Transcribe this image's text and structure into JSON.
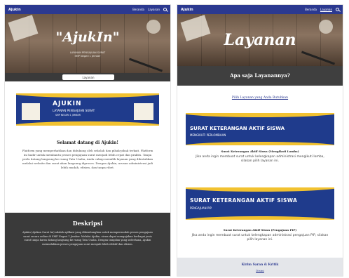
{
  "left": {
    "navbar": {
      "brand": "Ajukin",
      "links": [
        "Beranda",
        "Layanan"
      ]
    },
    "hero": {
      "title": "\"AjukIn\"",
      "sub1": "LAYANAN PENGAJUAN SURAT",
      "sub2": "SMP Negeri 1 Jember",
      "button": "Layanan"
    },
    "banner": {
      "title": "AJUKIN",
      "subtitle": "LAYANAN PENGAJUAN SURAT",
      "line": "SMP NEGERI 1 JEMBER"
    },
    "welcome": {
      "title": "Selamat datang di Ajukin!",
      "text": "Platform yang memperhatikan dan didukung oleh sekolah dan pihak-pihak terkait. Platform ini hadir untuk membantu proses pengajuan surat menjadi lebih cepat dan praktis. Tanpa perlu datang langsung ke ruang Tata Usaha, Anda cukup memilih layanan yang dibutuhkan melalui website dan surat akan langsung diproses. Dengan Ajukin, urusan administrasi jadi lebih mudah, efisien, dan tanpa ribet."
    },
    "deskripsi": {
      "title": "Deskripsi",
      "text": "Ajukin (Ajukan Surat Ini) adalah aplikasi yang dikembangkan untuk mempermudah proses pengajuan surat secara online di SMP Negeri 1 Jember. Melalui Ajukin, siswa dapat mengajukan berbagai jenis surat tanpa harus datang langsung ke ruang Tata Usaha. Dengan tampilan yang sederhana, Ajukin memudahkan proses pengajuan surat menjadi lebih efektif dan efisien."
    }
  },
  "right": {
    "navbar": {
      "brand": "Ajukin",
      "links": [
        "Beranda",
        "Layanan"
      ]
    },
    "hero": {
      "title": "Layanan"
    },
    "question": "Apa saja Layanannya?",
    "choose_link": "Pilih Layanan yang Anda Butuhkan",
    "cards": [
      {
        "banner_title": "SURAT KETERANGAN AKTIF SISWA",
        "banner_sub": "MENGIKUTI PERLOMBAAN",
        "caption": "Surat Keterangan Aktif Siswa (Mengikuti Lomba)",
        "text": "Jika anda ingin membuat surat untuk kelengkapan administrasi mengikuti lomba, silakan pilih layanan ini."
      },
      {
        "banner_title": "SURAT KETERANGAN AKTIF SISWA",
        "banner_sub": "PENGAJUAN PIP",
        "caption": "Surat Keterangan Aktif Siswa (Pengajuan PIP)",
        "text": "Jika anda ingin membuat surat untuk kelengkapan administrasi pengajuan PIP, silakan pilih layanan ini."
      }
    ],
    "footer": {
      "title": "Kirim Saran & Kritik",
      "link": "Disini"
    }
  },
  "colors": {
    "navbar": "#2b3990",
    "banner_blue": "#1f3b8c",
    "banner_yellow": "#f2c230",
    "dark_block": "#3a3a3a"
  },
  "icons": [
    "search-icon"
  ]
}
